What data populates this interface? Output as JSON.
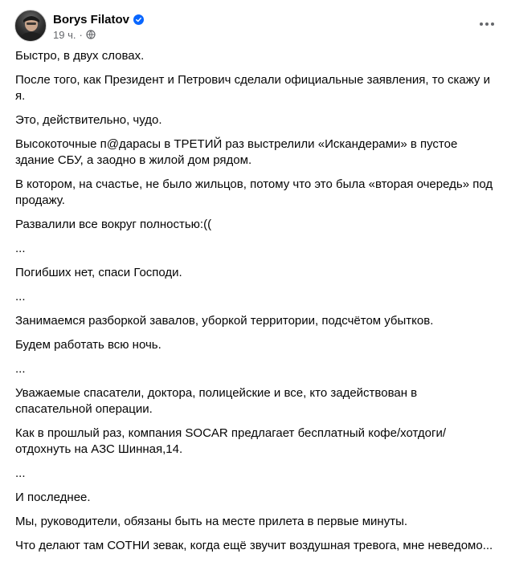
{
  "post": {
    "author": "Borys Filatov",
    "time": "19 ч.",
    "dot": "·",
    "paragraphs": [
      "Быстро, в двух словах.",
      "После того, как Президент и Петрович сделали официальные заявления, то скажу и я.",
      "Это, действительно, чудо.",
      "Высокоточные п@дарасы в ТРЕТИЙ раз выстрелили «Искандерами» в пустое здание СБУ, а заодно в жилой дом рядом.",
      "В котором, на счастье, не было жильцов, потому что это была «вторая очередь» под продажу.",
      "Развалили все вокруг полностью:((",
      "...",
      "Погибших нет, спаси Господи.",
      "...",
      "Занимаемся разборкой завалов, уборкой территории, подсчётом убытков.",
      "Будем работать всю ночь.",
      "...",
      "Уважаемые спасатели, доктора, полицейские и все, кто задействован в спасательной операции.",
      "Как в прошлый раз, компания SOCAR предлагает бесплатный кофе/хотдоги/отдохнуть на АЗС Шинная,14.",
      "...",
      "И последнее.",
      "Мы, руководители, обязаны быть на месте прилета в первые минуты.",
      "Что делают там СОТНИ зевак, когда ещё звучит воздушная тревога, мне неведомо..."
    ]
  },
  "colors": {
    "verified": "#0866ff",
    "meta": "#65676b",
    "text": "#050505"
  },
  "icons": {
    "verified": "verified-badge-icon",
    "audience": "globe-icon",
    "more": "more-options-icon"
  }
}
